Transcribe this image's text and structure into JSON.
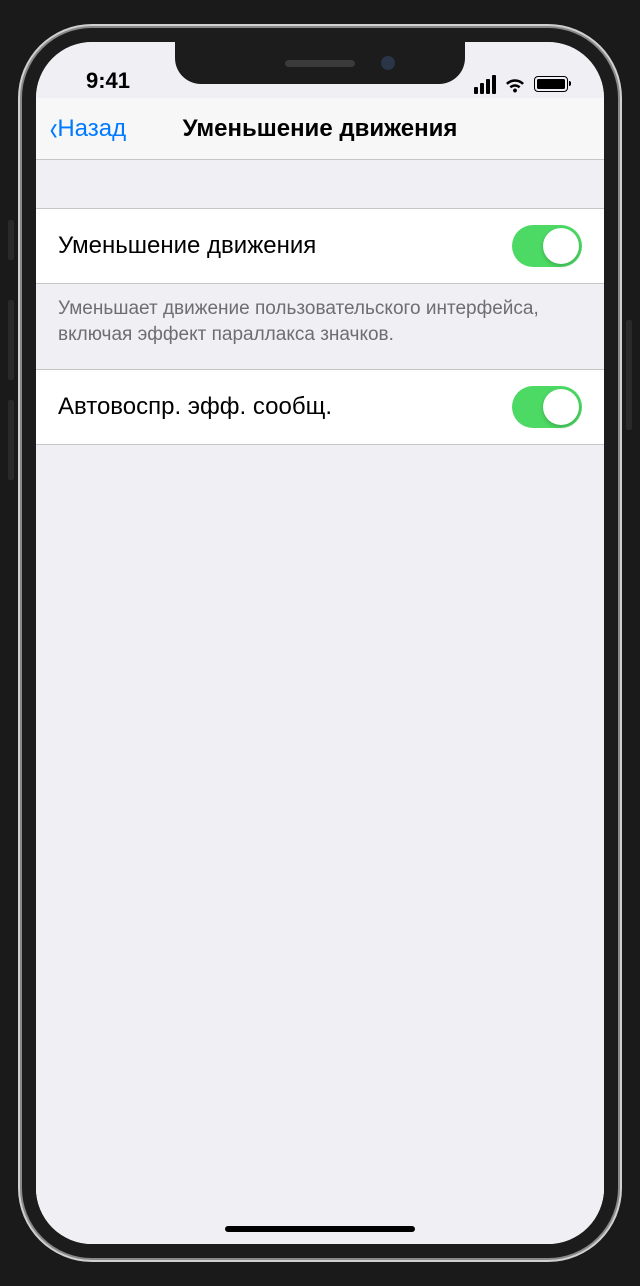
{
  "status_bar": {
    "time": "9:41"
  },
  "nav": {
    "back_label": "Назад",
    "title": "Уменьшение движения"
  },
  "settings": {
    "reduce_motion": {
      "label": "Уменьшение движения",
      "enabled": true,
      "description": "Уменьшает движение пользовательского интерфейса, включая эффект параллакса значков."
    },
    "auto_play_message_effects": {
      "label": "Автовоспр. эфф. сообщ.",
      "enabled": true
    }
  },
  "colors": {
    "accent": "#007aff",
    "toggle_on": "#4cd964"
  }
}
